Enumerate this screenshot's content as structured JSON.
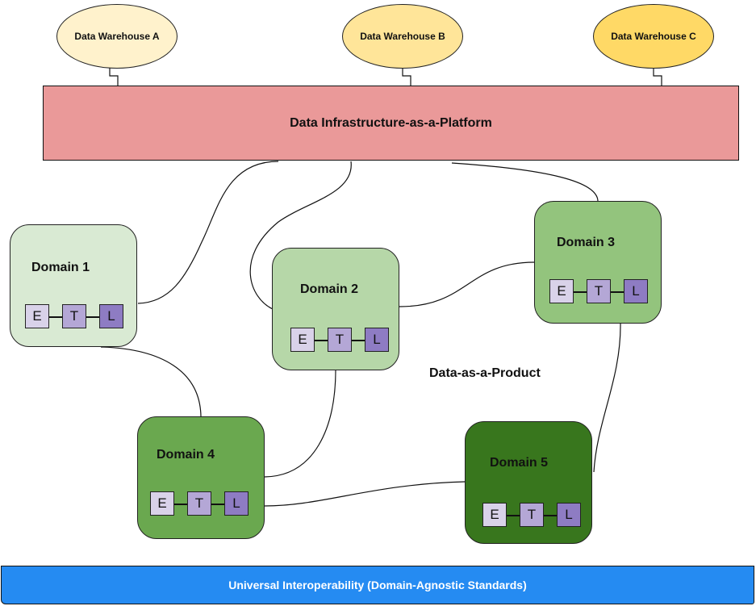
{
  "colors": {
    "warehouse_a": "#fff2cc",
    "warehouse_b": "#ffe599",
    "warehouse_c": "#ffd966",
    "platform": "#ea9999",
    "domain_1": "#d9ead3",
    "domain_2": "#b6d7a8",
    "domain_3": "#93c47d",
    "domain_4": "#6aa84f",
    "domain_5": "#38761d",
    "etl_e": "#d9d2e9",
    "etl_t": "#b4a7d6",
    "etl_l": "#8e7cc3",
    "interop": "#258bf2"
  },
  "warehouses": [
    {
      "label": "Data Warehouse A"
    },
    {
      "label": "Data Warehouse B"
    },
    {
      "label": "Data Warehouse C"
    }
  ],
  "platform": {
    "label": "Data Infrastructure-as-a-Platform"
  },
  "domains": [
    {
      "label": "Domain 1",
      "etl": [
        "E",
        "T",
        "L"
      ]
    },
    {
      "label": "Domain 2",
      "etl": [
        "E",
        "T",
        "L"
      ]
    },
    {
      "label": "Domain 3",
      "etl": [
        "E",
        "T",
        "L"
      ]
    },
    {
      "label": "Domain 4",
      "etl": [
        "E",
        "T",
        "L"
      ]
    },
    {
      "label": "Domain 5",
      "etl": [
        "E",
        "T",
        "L"
      ]
    }
  ],
  "product_label": "Data-as-a-Product",
  "interop": {
    "label": "Universal Interoperability (Domain-Agnostic Standards)"
  },
  "connections": [
    {
      "from": "Data Warehouse A",
      "to": "Data Infrastructure-as-a-Platform"
    },
    {
      "from": "Data Warehouse B",
      "to": "Data Infrastructure-as-a-Platform"
    },
    {
      "from": "Data Warehouse C",
      "to": "Data Infrastructure-as-a-Platform"
    },
    {
      "from": "Data Infrastructure-as-a-Platform",
      "to": "Domain 1"
    },
    {
      "from": "Data Infrastructure-as-a-Platform",
      "to": "Domain 2"
    },
    {
      "from": "Data Infrastructure-as-a-Platform",
      "to": "Domain 3"
    },
    {
      "from": "Domain 2",
      "to": "Domain 3"
    },
    {
      "from": "Domain 1",
      "to": "Domain 4"
    },
    {
      "from": "Domain 2",
      "to": "Domain 4"
    },
    {
      "from": "Domain 3",
      "to": "Domain 5"
    },
    {
      "from": "Domain 4",
      "to": "Domain 5"
    }
  ]
}
